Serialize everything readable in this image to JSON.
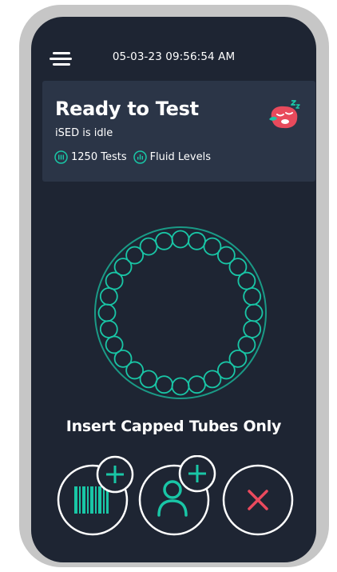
{
  "header": {
    "datetime": "05-03-23 09:56:54 AM"
  },
  "status": {
    "title": "Ready to Test",
    "subtitle": "iSED is idle",
    "mascot_icon": "sleeping-mascot-icon",
    "tests_label": "1250 Tests",
    "tests_icon": "tube-rack-icon",
    "fluid_label": "Fluid Levels",
    "fluid_icon": "fluid-levels-icon"
  },
  "rack": {
    "slot_count": 28
  },
  "instruction": "Insert Capped Tubes Only",
  "actions": {
    "scan_barcode": {
      "icon": "barcode-icon",
      "badge_icon": "plus-icon"
    },
    "add_patient": {
      "icon": "person-icon",
      "badge_icon": "plus-icon"
    },
    "cancel": {
      "icon": "close-icon"
    }
  },
  "colors": {
    "device_frame": "#c6c6c6",
    "screen_background": "#1e2533",
    "card_background": "#2b3547",
    "accent_teal": "#19c6a6",
    "ring_teal": "#1a9a86",
    "cancel_red": "#ea4a5e",
    "mascot_red": "#e84a5c"
  }
}
